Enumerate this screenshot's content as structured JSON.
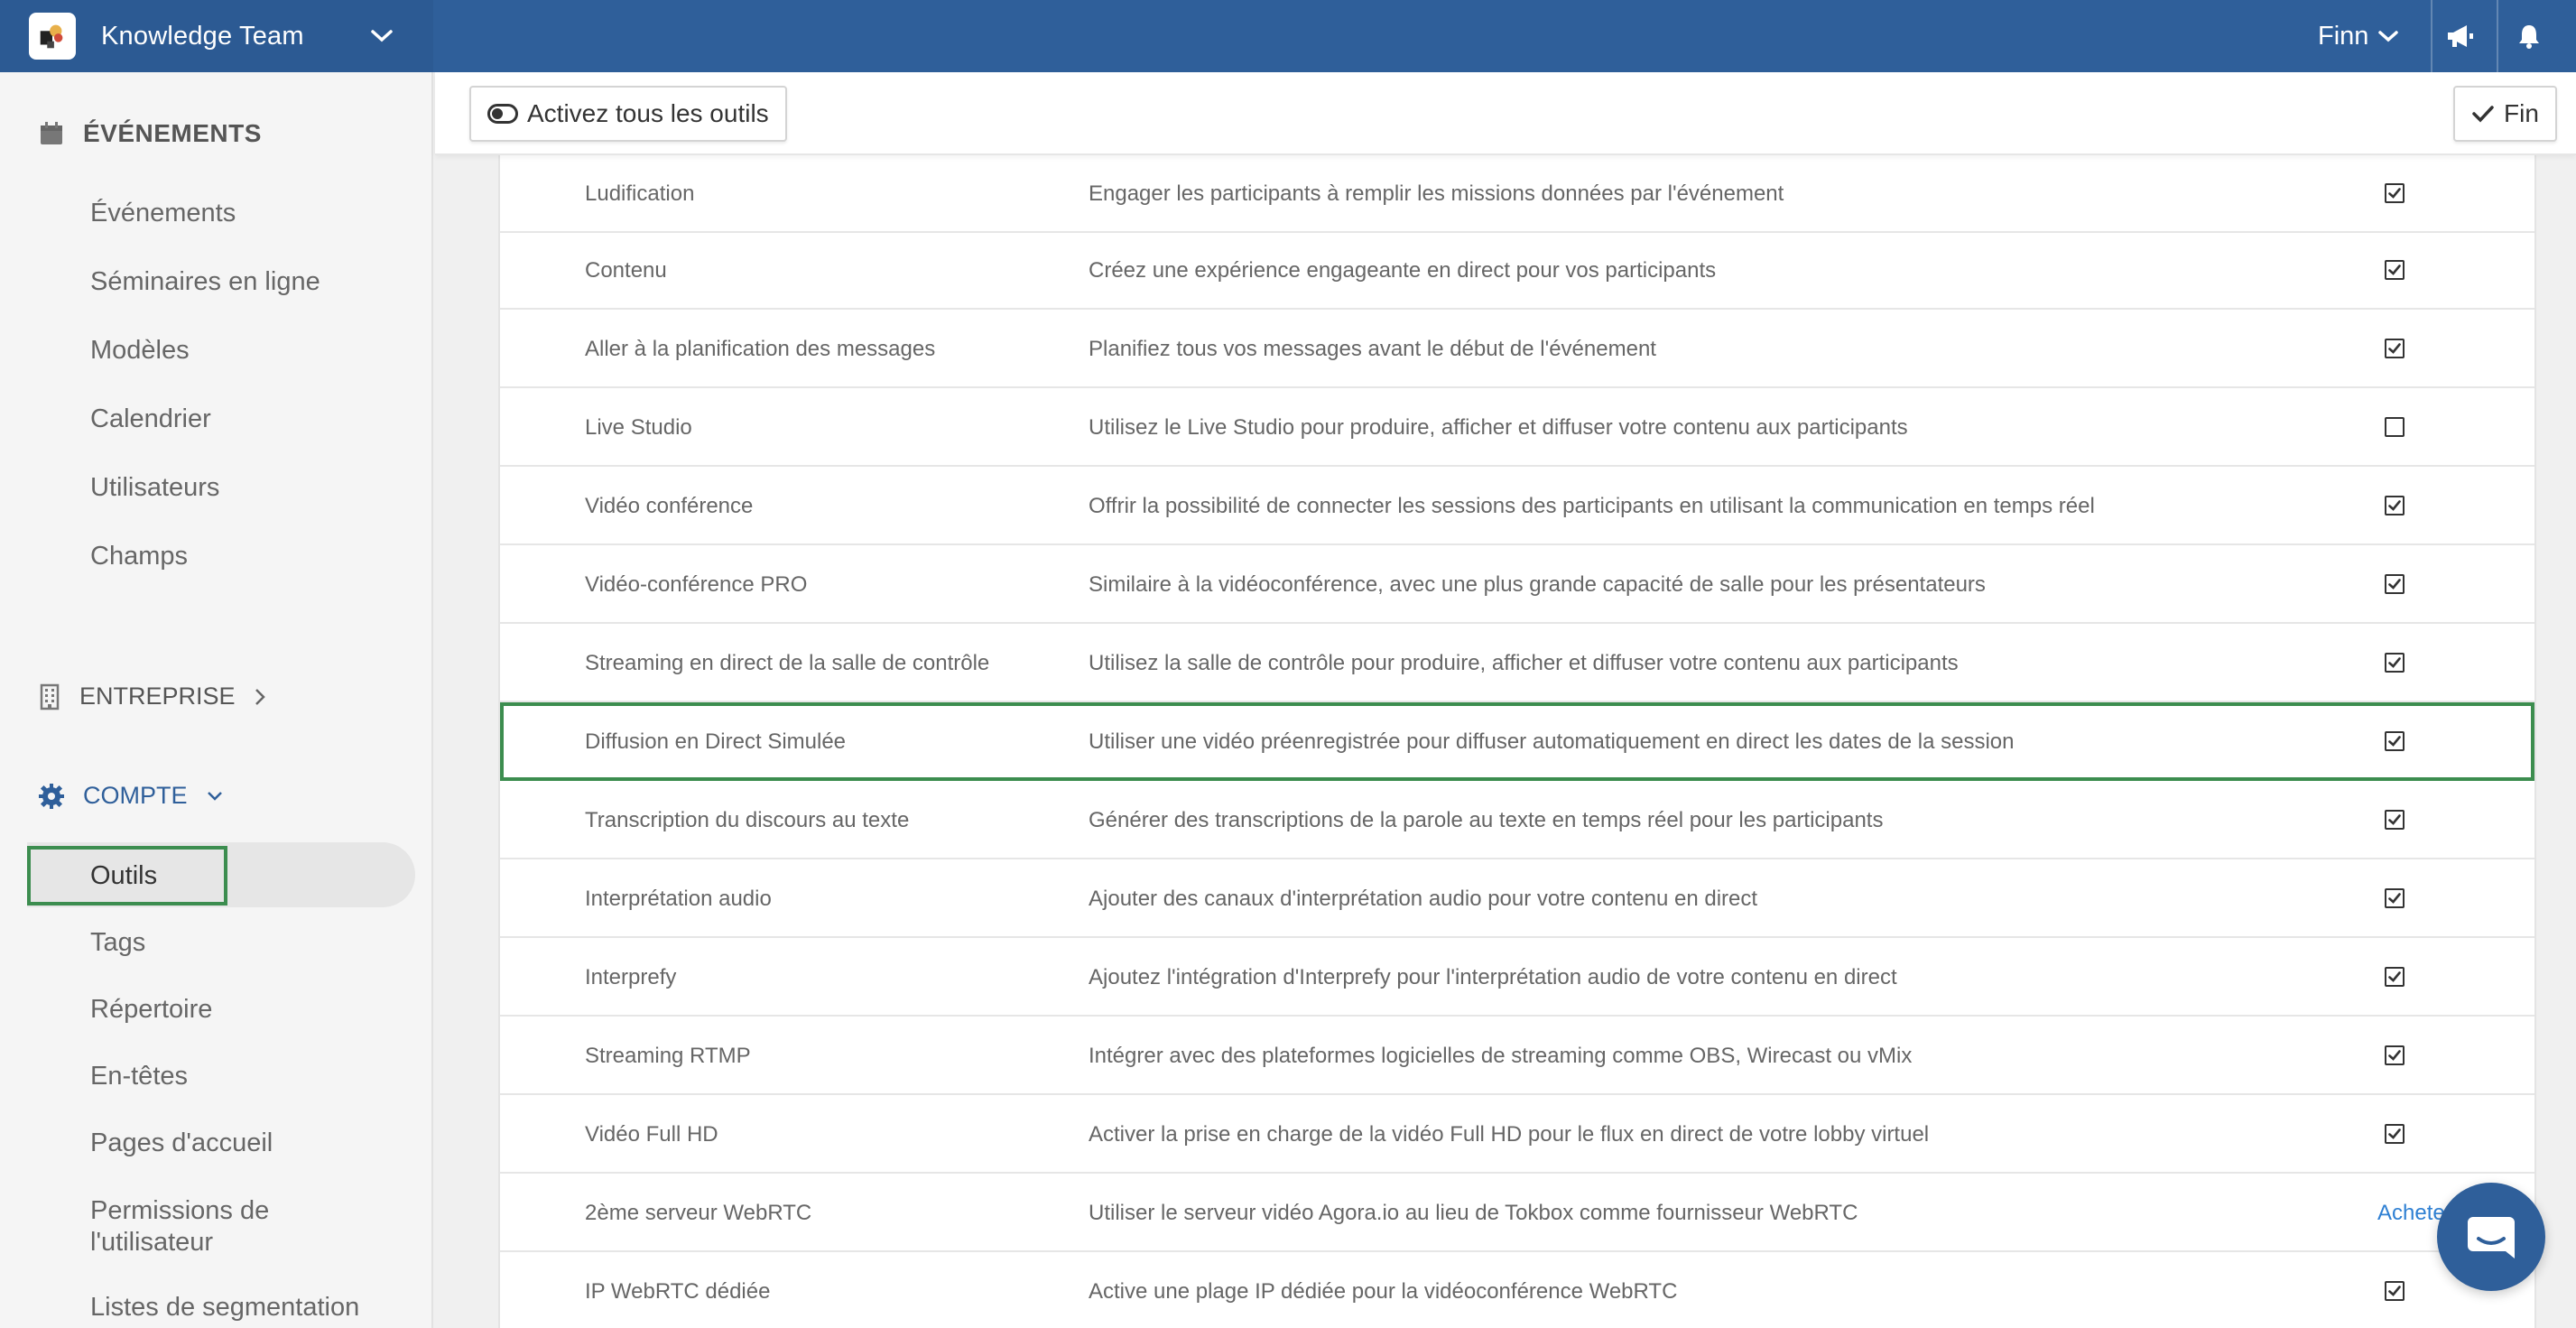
{
  "topbar": {
    "team_name": "Knowledge Team",
    "user_name": "Finn"
  },
  "sidebar": {
    "events_header": "ÉVÉNEMENTS",
    "events_items": [
      "Événements",
      "Séminaires en ligne",
      "Modèles",
      "Calendrier",
      "Utilisateurs",
      "Champs"
    ],
    "company_header": "ENTREPRISE",
    "account_header": "COMPTE",
    "account_items": [
      "Outils",
      "Tags",
      "Répertoire",
      "En-têtes",
      "Pages d'accueil",
      "Permissions de",
      "l'utilisateur",
      "Listes de segmentation"
    ],
    "active_item": "Outils"
  },
  "toolbar": {
    "activate_all_label": "Activez tous les outils",
    "fin_label": "Fin"
  },
  "tools": [
    {
      "name": "Ludification",
      "description": "Engager les participants à remplir les missions données par l'événement",
      "enabled": true
    },
    {
      "name": "Contenu",
      "description": "Créez une expérience engageante en direct pour vos participants",
      "enabled": true
    },
    {
      "name": "Aller à la planification des messages",
      "description": "Planifiez tous vos messages avant le début de l'événement",
      "enabled": true
    },
    {
      "name": "Live Studio",
      "description": "Utilisez le Live Studio pour produire, afficher et diffuser votre contenu aux participants",
      "enabled": false
    },
    {
      "name": "Vidéo conférence",
      "description": "Offrir la possibilité de connecter les sessions des participants en utilisant la communication en temps réel",
      "enabled": true
    },
    {
      "name": "Vidéo-conférence PRO",
      "description": "Similaire à la vidéoconférence, avec une plus grande capacité de salle pour les présentateurs",
      "enabled": true
    },
    {
      "name": "Streaming en direct de la salle de contrôle",
      "description": "Utilisez la salle de contrôle pour produire, afficher et diffuser votre contenu aux participants",
      "enabled": true
    },
    {
      "name": "Diffusion en Direct Simulée",
      "description": "Utiliser une vidéo préenregistrée pour diffuser automatiquement en direct les dates de la session",
      "enabled": true
    },
    {
      "name": "Transcription du discours au texte",
      "description": "Générer des transcriptions de la parole au texte en temps réel pour les participants",
      "enabled": true
    },
    {
      "name": "Interprétation audio",
      "description": "Ajouter des canaux d'interprétation audio pour votre contenu en direct",
      "enabled": true
    },
    {
      "name": "Interprefy",
      "description": "Ajoutez l'intégration d'Interprefy pour l'interprétation audio de votre contenu en direct",
      "enabled": true
    },
    {
      "name": "Streaming RTMP",
      "description": "Intégrer avec des plateformes logicielles de streaming comme OBS, Wirecast ou vMix",
      "enabled": true
    },
    {
      "name": "Vidéo Full HD",
      "description": "Activer la prise en charge de la vidéo Full HD pour le flux en direct de votre lobby virtuel",
      "enabled": true
    },
    {
      "name": "2ème serveur WebRTC",
      "description": "Utiliser le serveur vidéo Agora.io au lieu de Tokbox comme fournisseur WebRTC",
      "action": "Acheter"
    },
    {
      "name": "IP WebRTC dédiée",
      "description": "Active une plage IP dédiée pour la vidéoconférence WebRTC",
      "enabled": true
    }
  ],
  "highlighted_tool": "Diffusion en Direct Simulée",
  "colors": {
    "topbar": "#2f5f9a",
    "highlight": "#3c8d4f",
    "link": "#2f80d3"
  }
}
